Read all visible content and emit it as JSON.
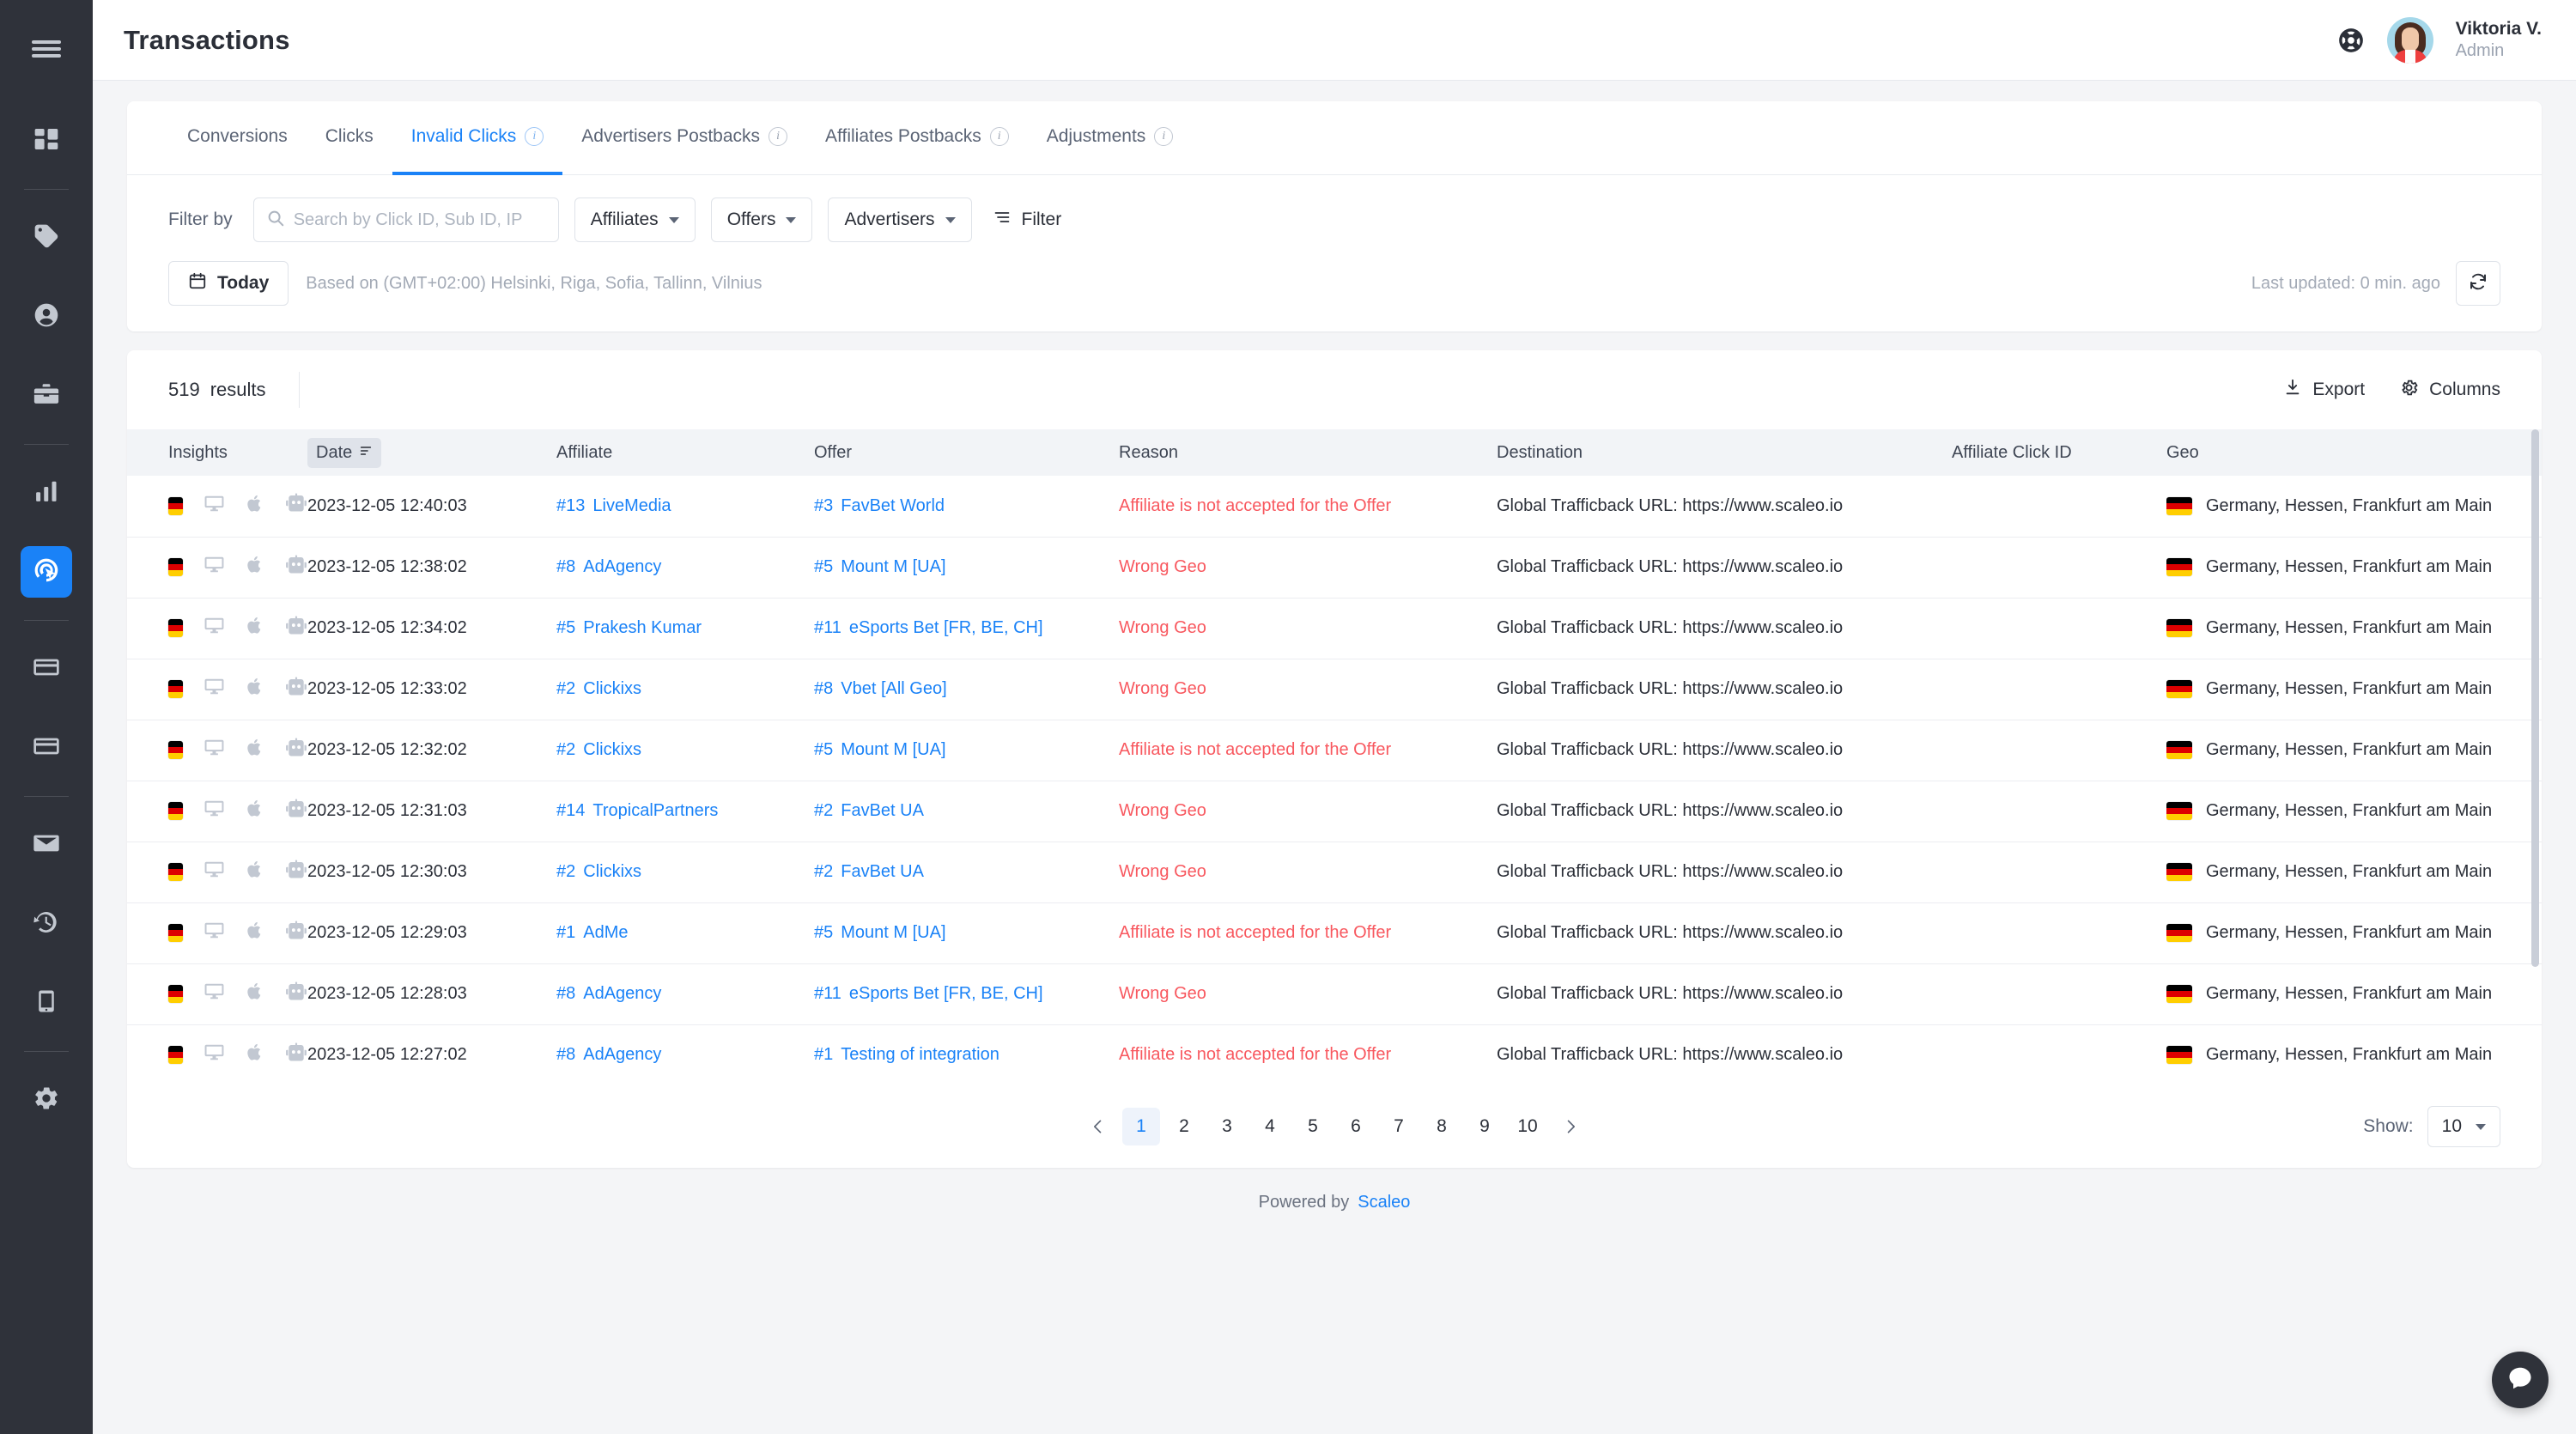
{
  "sidebar": {
    "menu_toggle": "menu-icon",
    "groups": [
      {
        "items": [
          {
            "icon": "dashboard-icon",
            "active": false
          }
        ]
      },
      {
        "items": [
          {
            "icon": "tag-icon",
            "active": false
          },
          {
            "icon": "user-icon",
            "active": false
          },
          {
            "icon": "briefcase-icon",
            "active": false
          }
        ]
      },
      {
        "items": [
          {
            "icon": "bar-chart-icon",
            "active": false
          },
          {
            "icon": "click-target-icon",
            "active": true
          }
        ]
      },
      {
        "items": [
          {
            "icon": "credit-card-icon",
            "active": false
          },
          {
            "icon": "payment-card-icon",
            "active": false
          }
        ]
      },
      {
        "items": [
          {
            "icon": "mail-icon",
            "active": false
          },
          {
            "icon": "history-icon",
            "active": false
          },
          {
            "icon": "mobile-icon",
            "active": false
          }
        ]
      },
      {
        "items": [
          {
            "icon": "gear-icon",
            "active": false
          }
        ]
      }
    ]
  },
  "header": {
    "title": "Transactions",
    "help_icon": "lifebuoy-icon",
    "user": {
      "name": "Viktoria V.",
      "role": "Admin"
    }
  },
  "tabs": [
    {
      "label": "Conversions",
      "active": false,
      "info": false
    },
    {
      "label": "Clicks",
      "active": false,
      "info": false
    },
    {
      "label": "Invalid Clicks",
      "active": true,
      "info": true
    },
    {
      "label": "Advertisers Postbacks",
      "active": false,
      "info": true
    },
    {
      "label": "Affiliates Postbacks",
      "active": false,
      "info": true
    },
    {
      "label": "Adjustments",
      "active": false,
      "info": true
    }
  ],
  "filters": {
    "label": "Filter by",
    "search_placeholder": "Search by Click ID, Sub ID, IP",
    "search_value": "",
    "dropdowns": [
      "Affiliates",
      "Offers",
      "Advertisers"
    ],
    "filter_button": "Filter"
  },
  "daterange": {
    "preset": "Today",
    "timezone_note": "Based on (GMT+02:00) Helsinki, Riga, Sofia, Tallinn, Vilnius",
    "last_updated": "Last updated: 0 min. ago",
    "refresh_icon": "refresh-icon"
  },
  "table_toolbar": {
    "results_count": "519",
    "results_word": "results",
    "export_label": "Export",
    "columns_label": "Columns"
  },
  "table": {
    "columns": [
      {
        "label": "Insights",
        "sorted": false
      },
      {
        "label": "Date",
        "sorted": true
      },
      {
        "label": "Affiliate",
        "sorted": false
      },
      {
        "label": "Offer",
        "sorted": false
      },
      {
        "label": "Reason",
        "sorted": false
      },
      {
        "label": "Destination",
        "sorted": false
      },
      {
        "label": "Affiliate Click ID",
        "sorted": false
      },
      {
        "label": "Geo",
        "sorted": false
      }
    ],
    "rows": [
      {
        "insights": [
          "de-flag",
          "desktop-icon",
          "apple-icon",
          "bot-icon"
        ],
        "date": "2023-12-05 12:40:03",
        "affiliate_id": "#13",
        "affiliate": "LiveMedia",
        "offer_id": "#3",
        "offer": "FavBet World",
        "reason": "Affiliate is not accepted for the Offer",
        "destination": "Global Trafficback URL: https://www.scaleo.io",
        "click_id": "",
        "geo": "Germany, Hessen, Frankfurt am Main"
      },
      {
        "insights": [
          "de-flag",
          "desktop-icon",
          "apple-icon",
          "bot-icon"
        ],
        "date": "2023-12-05 12:38:02",
        "affiliate_id": "#8",
        "affiliate": "AdAgency",
        "offer_id": "#5",
        "offer": "Mount M [UA]",
        "reason": "Wrong Geo",
        "destination": "Global Trafficback URL: https://www.scaleo.io",
        "click_id": "",
        "geo": "Germany, Hessen, Frankfurt am Main"
      },
      {
        "insights": [
          "de-flag",
          "desktop-icon",
          "apple-icon",
          "bot-icon"
        ],
        "date": "2023-12-05 12:34:02",
        "affiliate_id": "#5",
        "affiliate": "Prakesh Kumar",
        "offer_id": "#11",
        "offer": "eSports Bet [FR, BE, CH]",
        "reason": "Wrong Geo",
        "destination": "Global Trafficback URL: https://www.scaleo.io",
        "click_id": "",
        "geo": "Germany, Hessen, Frankfurt am Main"
      },
      {
        "insights": [
          "de-flag",
          "desktop-icon",
          "apple-icon",
          "bot-icon"
        ],
        "date": "2023-12-05 12:33:02",
        "affiliate_id": "#2",
        "affiliate": "Clickixs",
        "offer_id": "#8",
        "offer": "Vbet [All Geo]",
        "reason": "Wrong Geo",
        "destination": "Global Trafficback URL: https://www.scaleo.io",
        "click_id": "",
        "geo": "Germany, Hessen, Frankfurt am Main"
      },
      {
        "insights": [
          "de-flag",
          "desktop-icon",
          "apple-icon",
          "bot-icon"
        ],
        "date": "2023-12-05 12:32:02",
        "affiliate_id": "#2",
        "affiliate": "Clickixs",
        "offer_id": "#5",
        "offer": "Mount M [UA]",
        "reason": "Affiliate is not accepted for the Offer",
        "destination": "Global Trafficback URL: https://www.scaleo.io",
        "click_id": "",
        "geo": "Germany, Hessen, Frankfurt am Main"
      },
      {
        "insights": [
          "de-flag",
          "desktop-icon",
          "apple-icon",
          "bot-icon"
        ],
        "date": "2023-12-05 12:31:03",
        "affiliate_id": "#14",
        "affiliate": "TropicalPartners",
        "offer_id": "#2",
        "offer": "FavBet UA",
        "reason": "Wrong Geo",
        "destination": "Global Trafficback URL: https://www.scaleo.io",
        "click_id": "",
        "geo": "Germany, Hessen, Frankfurt am Main"
      },
      {
        "insights": [
          "de-flag",
          "desktop-icon",
          "apple-icon",
          "bot-icon"
        ],
        "date": "2023-12-05 12:30:03",
        "affiliate_id": "#2",
        "affiliate": "Clickixs",
        "offer_id": "#2",
        "offer": "FavBet UA",
        "reason": "Wrong Geo",
        "destination": "Global Trafficback URL: https://www.scaleo.io",
        "click_id": "",
        "geo": "Germany, Hessen, Frankfurt am Main"
      },
      {
        "insights": [
          "de-flag",
          "desktop-icon",
          "apple-icon",
          "bot-icon"
        ],
        "date": "2023-12-05 12:29:03",
        "affiliate_id": "#1",
        "affiliate": "AdMe",
        "offer_id": "#5",
        "offer": "Mount M [UA]",
        "reason": "Affiliate is not accepted for the Offer",
        "destination": "Global Trafficback URL: https://www.scaleo.io",
        "click_id": "",
        "geo": "Germany, Hessen, Frankfurt am Main"
      },
      {
        "insights": [
          "de-flag",
          "desktop-icon",
          "apple-icon",
          "bot-icon"
        ],
        "date": "2023-12-05 12:28:03",
        "affiliate_id": "#8",
        "affiliate": "AdAgency",
        "offer_id": "#11",
        "offer": "eSports Bet [FR, BE, CH]",
        "reason": "Wrong Geo",
        "destination": "Global Trafficback URL: https://www.scaleo.io",
        "click_id": "",
        "geo": "Germany, Hessen, Frankfurt am Main"
      },
      {
        "insights": [
          "de-flag",
          "desktop-icon",
          "apple-icon",
          "bot-icon"
        ],
        "date": "2023-12-05 12:27:02",
        "affiliate_id": "#8",
        "affiliate": "AdAgency",
        "offer_id": "#1",
        "offer": "Testing of integration",
        "reason": "Affiliate is not accepted for the Offer",
        "destination": "Global Trafficback URL: https://www.scaleo.io",
        "click_id": "",
        "geo": "Germany, Hessen, Frankfurt am Main"
      }
    ]
  },
  "pagination": {
    "prev_icon": "chevron-left-icon",
    "next_icon": "chevron-right-icon",
    "pages": [
      "1",
      "2",
      "3",
      "4",
      "5",
      "6",
      "7",
      "8",
      "9",
      "10"
    ],
    "current": "1",
    "show_label": "Show:",
    "show_value": "10"
  },
  "footer": {
    "text": "Powered by",
    "brand": "Scaleo"
  },
  "intercom": {
    "icon": "chat-icon"
  },
  "colors": {
    "accent": "#1a82f7",
    "danger": "#f8585f",
    "sidebar_bg": "#2f323a",
    "page_bg": "#f4f5f7",
    "header_bg": "#f2f4f7"
  }
}
